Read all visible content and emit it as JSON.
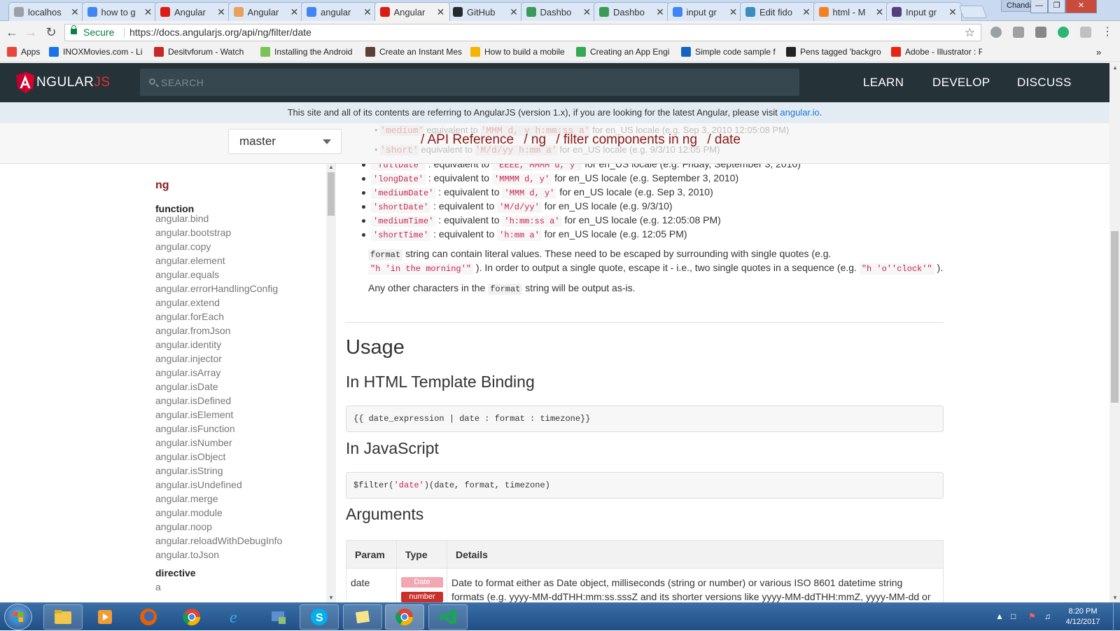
{
  "browser": {
    "tabs": [
      {
        "label": "localhos",
        "fav_color": "#9aa0a6",
        "active": false
      },
      {
        "label": "how to g",
        "fav_color": "#4285f4",
        "active": false
      },
      {
        "label": "Angular",
        "fav_color": "#dd1b16",
        "active": false
      },
      {
        "label": "Angular",
        "fav_color": "#e8a15a",
        "active": false
      },
      {
        "label": "angular",
        "fav_color": "#4285f4",
        "active": false
      },
      {
        "label": "Angular",
        "fav_color": "#dd1b16",
        "active": true
      },
      {
        "label": "GitHub",
        "fav_color": "#24292e",
        "active": false
      },
      {
        "label": "Dashbo",
        "fav_color": "#3b9a5a",
        "active": false
      },
      {
        "label": "Dashbo",
        "fav_color": "#3b9a5a",
        "active": false
      },
      {
        "label": "input gr",
        "fav_color": "#4285f4",
        "active": false
      },
      {
        "label": "Edit fido",
        "fav_color": "#3c8dbc",
        "active": false
      },
      {
        "label": "html - M",
        "fav_color": "#f48024",
        "active": false
      },
      {
        "label": "Input gr",
        "fav_color": "#563d7c",
        "active": false
      }
    ],
    "user": "Chandan",
    "address": {
      "secure_label": "Secure",
      "url": "https://docs.angularjs.org/api/ng/filter/date"
    },
    "bookmarks": [
      {
        "label": "Apps",
        "color": "#e8453c"
      },
      {
        "label": "INOXMovies.com - Li",
        "color": "#1a73e8"
      },
      {
        "label": "Desitvforum - Watch",
        "color": "#c62828"
      },
      {
        "label": "Installing the Android",
        "color": "#78c257"
      },
      {
        "label": "Create an Instant Mes",
        "color": "#5d4037"
      },
      {
        "label": "How to build a mobile",
        "color": "#f4b400"
      },
      {
        "label": "Creating an App Engi",
        "color": "#34a853"
      },
      {
        "label": "Simple code sample f",
        "color": "#1565c0"
      },
      {
        "label": "Pens tagged 'backgro",
        "color": "#222222"
      },
      {
        "label": "Adobe - Illustrator : F",
        "color": "#e8260f"
      }
    ]
  },
  "site": {
    "logo": {
      "main": "NGULAR",
      "js": "JS"
    },
    "search_placeholder": "SEARCH",
    "nav": [
      "LEARN",
      "DEVELOP",
      "DISCUSS"
    ],
    "notice_text": "This site and all of its contents are referring to AngularJS (version 1.x), if you are looking for the latest Angular, please visit ",
    "notice_link": "angular.io",
    "notice_end": ".",
    "version": "master",
    "breadcrumb": [
      "/ API Reference",
      "/ ng",
      "/ filter components in ng",
      "/ date"
    ],
    "ghost_lines": [
      {
        "code": "'medium'",
        "mid": " equivalent to ",
        "code2": "'MMM d, y h:mm:ss a'",
        "text": " for en_US locale (e.g. Sep 3, 2010 12:05:08 PM)"
      },
      {
        "code": "'short'",
        "mid": " equivalent to ",
        "code2": "'M/d/yy h:mm a'",
        "text": " for en_US locale (e.g. 9/3/10 12:05 PM)"
      }
    ]
  },
  "sidebar": {
    "heading": "ng",
    "section_function": "function",
    "functions": [
      "angular.bind",
      "angular.bootstrap",
      "angular.copy",
      "angular.element",
      "angular.equals",
      "angular.errorHandlingConfig",
      "angular.extend",
      "angular.forEach",
      "angular.fromJson",
      "angular.identity",
      "angular.injector",
      "angular.isArray",
      "angular.isDate",
      "angular.isDefined",
      "angular.isElement",
      "angular.isFunction",
      "angular.isNumber",
      "angular.isObject",
      "angular.isString",
      "angular.isUndefined",
      "angular.merge",
      "angular.module",
      "angular.noop",
      "angular.reloadWithDebugInfo",
      "angular.toJson"
    ],
    "section_directive": "directive",
    "directives": [
      "a"
    ]
  },
  "content": {
    "formats": [
      {
        "name": "'fullDate'",
        "pattern": "'EEEE, MMMM d, y'",
        "example": " for en_US locale (e.g. Friday, September 3, 2010)"
      },
      {
        "name": "'longDate'",
        "pattern": "'MMMM d, y'",
        "example": " for en_US locale (e.g. September 3, 2010)"
      },
      {
        "name": "'mediumDate'",
        "pattern": "'MMM d, y'",
        "example": " for en_US locale (e.g. Sep 3, 2010)"
      },
      {
        "name": "'shortDate'",
        "pattern": "'M/d/yy'",
        "example": " for en_US locale (e.g. 9/3/10)"
      },
      {
        "name": "'mediumTime'",
        "pattern": "'h:mm:ss a'",
        "example": " for en_US locale (e.g. 12:05:08 PM)"
      },
      {
        "name": "'shortTime'",
        "pattern": "'h:mm a'",
        "example": " for en_US locale (e.g. 12:05 PM)"
      }
    ],
    "equivalent_to": " : equivalent to ",
    "literal_p1_code": "format",
    "literal_p1_text": " string can contain literal values. These need to be escaped by surrounding with single quotes (e.g.",
    "literal_p2_code": "\"h 'in the morning'\"",
    "literal_p2_text": "). In order to output a single quote, escape it - i.e., two single quotes in a sequence (e.g. ",
    "literal_p2_code2": "\"h 'o''clock'\"",
    "literal_p2_end": ").",
    "other_p_start": "Any other characters in the ",
    "other_p_code": "format",
    "other_p_end": " string will be output as-is.",
    "usage_title": "Usage",
    "html_binding_title": "In HTML Template Binding",
    "html_binding_code": "{{ date_expression | date : format : timezone}}",
    "js_title": "In JavaScript",
    "js_code_pre": "$filter(",
    "js_code_str": "'date'",
    "js_code_post": ")(date, format, timezone)",
    "arguments_title": "Arguments",
    "table_headers": [
      "Param",
      "Type",
      "Details"
    ],
    "row": {
      "param": "date",
      "types": [
        {
          "label": "Date",
          "color": "#f2a7b2"
        },
        {
          "label": "number",
          "color": "#c9302c"
        }
      ],
      "details_line1": "Date to format either as Date object, milliseconds (string or number) or various ISO 8601 datetime string",
      "details_line2": "formats (e.g. yyyy-MM-ddTHH:mm:ss.sssZ and its shorter versions like yyyy-MM-ddTHH:mmZ, yyyy-MM-dd or"
    }
  },
  "taskbar": {
    "clock_time": "8:20 PM",
    "clock_date": "4/12/2017"
  }
}
